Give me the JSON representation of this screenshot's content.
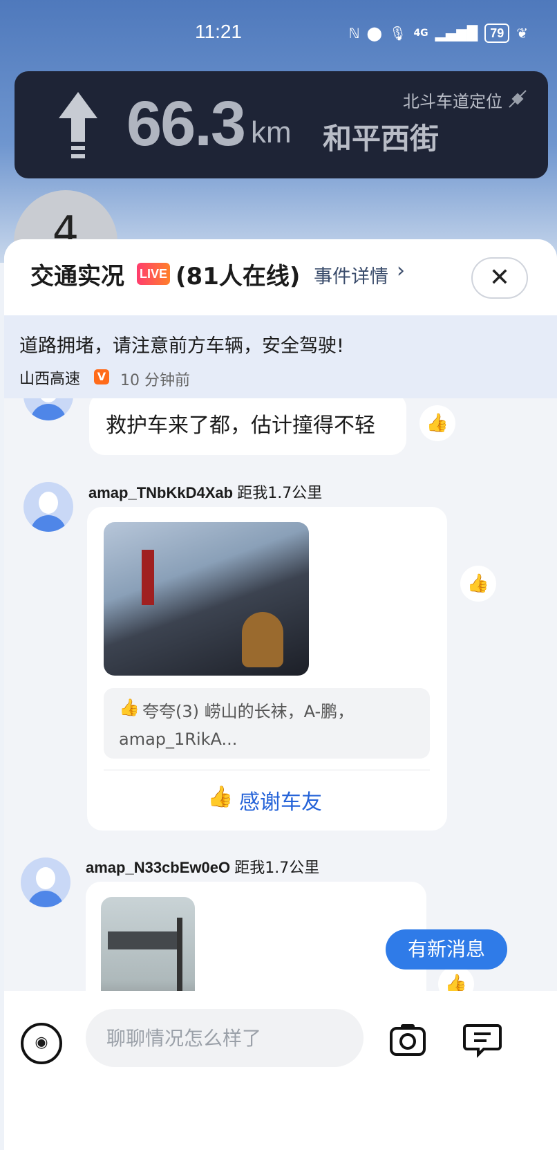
{
  "status_bar": {
    "time": "11:21",
    "network": "4G",
    "battery": "79"
  },
  "navigation": {
    "distance": "66.3",
    "unit": "km",
    "road": "和平西街",
    "positioning": "北斗车道定位",
    "lane_number": "4"
  },
  "panel": {
    "title": "交通实况",
    "live_badge": "LIVE",
    "online": "(81人在线)",
    "detail_link": "事件详情",
    "detail_arrow": "›",
    "close_icon": "✕"
  },
  "notice": {
    "text": "道路拥堵，请注意前方车辆，安全驾驶!",
    "source": "山西高速",
    "verified_badge": "V",
    "time_ago": "10 分钟前"
  },
  "messages": [
    {
      "text": "救护车来了都，估计撞得不轻"
    },
    {
      "username": "amap_TNbKkD4Xab",
      "distance": "距我1.7公里",
      "praise": "夸夸(3) 崂山的长袜，A-鹏，amap_1RikA...",
      "thanks_label": "感谢车友"
    },
    {
      "username": "amap_N33cbEw0eO",
      "distance": "距我1.7公里"
    }
  ],
  "new_message_label": "有新消息",
  "input": {
    "placeholder": "聊聊情况怎么样了"
  },
  "colors": {
    "accent": "#2f7be8",
    "nav_bg": "#1e2436",
    "live_start": "#ff3d6e",
    "live_end": "#ff7f2a"
  }
}
